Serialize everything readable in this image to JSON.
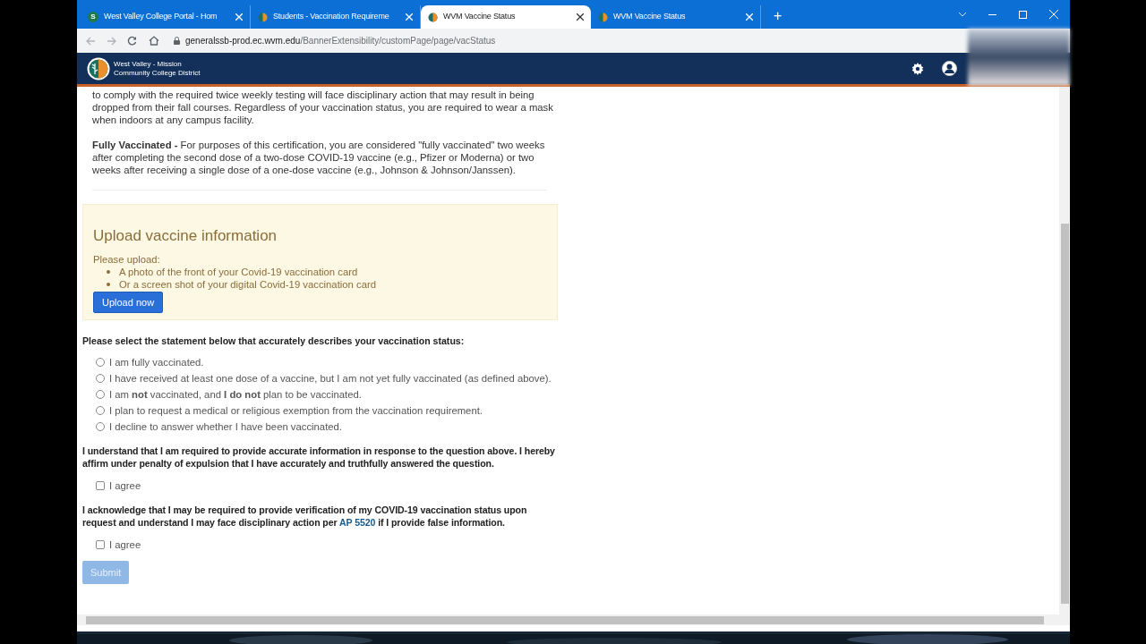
{
  "browser": {
    "tabs": [
      {
        "title": "West Valley College Portal - Hom",
        "kind": "letter",
        "icon_text": "S",
        "selected": false
      },
      {
        "title": "Students - Vaccination Requireme",
        "kind": "logo",
        "selected": false
      },
      {
        "title": "WVM Vaccine Status",
        "kind": "logo",
        "selected": true
      },
      {
        "title": "WVM Vaccine Status",
        "kind": "logo",
        "selected": false
      }
    ],
    "new_tab": "+",
    "url": {
      "host": "generalssb-prod.ec.wvm.edu",
      "path": "/BannerExtensibility/customPage/page/vacStatus"
    }
  },
  "header": {
    "logo_lines": [
      "West Valley - Mission",
      "Community College District"
    ]
  },
  "content": {
    "paragraphs": [
      "to comply with the required twice weekly testing will face disciplinary action that may result in being dropped from their fall courses. Regardless of your vaccination status, you are required to wear a mask when indoors at any campus facility.",
      "**Fully Vaccinated -** For purposes of this certification, you are considered \"fully vaccinated\" two weeks after completing the second dose of a two-dose COVID-19 vaccine (e.g., Pfizer or Moderna) or two weeks after receiving a single dose of a one-dose vaccine (e.g., Johnson & Johnson/Janssen)."
    ],
    "upload_card": {
      "title": "Upload vaccine information",
      "prompt": "Please upload:",
      "bullets": [
        "A photo of the front of your Covid-19 vaccination card",
        "Or a screen shot of your digital Covid-19 vaccination card"
      ],
      "button": "Upload now"
    },
    "question": "Please select the statement below that accurately describes your vaccination status:",
    "options": [
      {
        "label": "I am fully vaccinated.",
        "selected": false
      },
      {
        "label": "I have received at least one dose of a vaccine, but I am not yet fully vaccinated (as defined above).",
        "selected": false
      },
      {
        "label": "I am **not** vaccinated, and **I do not** plan to be vaccinated.",
        "selected": false
      },
      {
        "label": "I plan to request a medical or religious exemption from the vaccination requirement.",
        "selected": false
      },
      {
        "label": "I decline to answer whether I have been vaccinated.",
        "selected": false
      }
    ],
    "affirmations": [
      {
        "text": "I understand that I am required to provide accurate information in response to the question above. I hereby affirm under penalty of expulsion that I have accurately and truthfully answered the question.",
        "checkbox": {
          "label": "I agree",
          "checked": false
        }
      },
      {
        "text": "I acknowledge that I may be required to provide verification of my COVID-19 vaccination status upon request and understand I may face disciplinary action per",
        "link": "AP 5520",
        "text_after": "if I provide false information.",
        "checkbox": {
          "label": "I agree",
          "checked": false
        }
      }
    ],
    "submit": {
      "label": "Submit",
      "disabled": true
    }
  }
}
